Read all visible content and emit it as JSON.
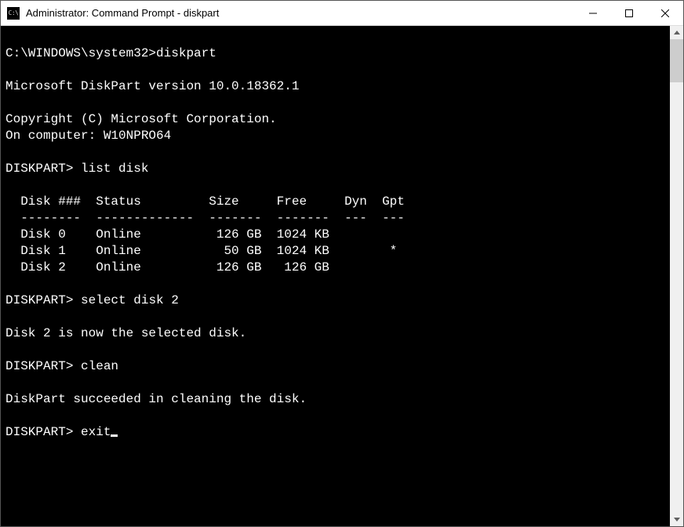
{
  "window": {
    "title": "Administrator: Command Prompt - diskpart"
  },
  "terminal": {
    "prompt_initial": "C:\\WINDOWS\\system32>",
    "cmd_diskpart": "diskpart",
    "version_line": "Microsoft DiskPart version 10.0.18362.1",
    "copyright_line": "Copyright (C) Microsoft Corporation.",
    "on_computer_line": "On computer: W10NPRO64",
    "prompt_dp": "DISKPART>",
    "cmd_list_disk": " list disk",
    "table_header": "  Disk ###  Status         Size     Free     Dyn  Gpt",
    "table_divider": "  --------  -------------  -------  -------  ---  ---",
    "table_rows": [
      "  Disk 0    Online          126 GB  1024 KB            ",
      "  Disk 1    Online           50 GB  1024 KB        *   ",
      "  Disk 2    Online          126 GB   126 GB            "
    ],
    "cmd_select": " select disk 2",
    "select_result": "Disk 2 is now the selected disk.",
    "cmd_clean": " clean",
    "clean_result": "DiskPart succeeded in cleaning the disk.",
    "cmd_exit": " exit"
  },
  "chart_data": {
    "type": "table",
    "title": "list disk",
    "columns": [
      "Disk ###",
      "Status",
      "Size",
      "Free",
      "Dyn",
      "Gpt"
    ],
    "rows": [
      {
        "Disk ###": "Disk 0",
        "Status": "Online",
        "Size": "126 GB",
        "Free": "1024 KB",
        "Dyn": "",
        "Gpt": ""
      },
      {
        "Disk ###": "Disk 1",
        "Status": "Online",
        "Size": "50 GB",
        "Free": "1024 KB",
        "Dyn": "",
        "Gpt": "*"
      },
      {
        "Disk ###": "Disk 2",
        "Status": "Online",
        "Size": "126 GB",
        "Free": "126 GB",
        "Dyn": "",
        "Gpt": ""
      }
    ]
  }
}
